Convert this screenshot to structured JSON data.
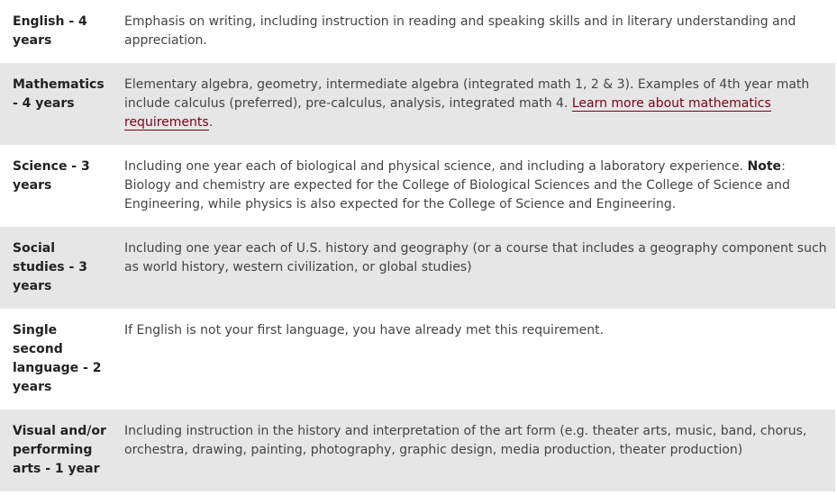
{
  "requirements": [
    {
      "subject": "English - 4 years",
      "description": "Emphasis on writing, including instruction in reading and speaking skills and in literary understanding and appreciation."
    },
    {
      "subject": "Mathematics - 4 years",
      "description": "Elementary algebra, geometry, intermediate algebra (integrated math 1, 2 & 3). Examples of 4th year math include calculus (preferred), pre-calculus, analysis, integrated math 4.",
      "link_text": "Learn more about mathematics requirements",
      "after_link": "."
    },
    {
      "subject": "Science - 3 years",
      "description": "Including one year each of biological and physical science, and including a laboratory experience.",
      "note_label": "Note",
      "note_text": ": Biology and chemistry are expected for the College of Biological Sciences and the College of Science and Engineering, while physics is also expected for the College of Science and Engineering."
    },
    {
      "subject": "Social studies - 3 years",
      "description": "Including one year each of U.S. history and geography (or a course that includes a geography component such as world history, western civilization, or global studies)"
    },
    {
      "subject": "Single second language - 2 years",
      "description": "If English is not your first language, you have already met this requirement."
    },
    {
      "subject": "Visual and/or performing arts - 1 year",
      "description": "Including instruction in the history and interpretation of the art form (e.g. theater arts, music, band, chorus, orchestra, drawing, painting, photography, graphic design, media production, theater production)"
    }
  ]
}
